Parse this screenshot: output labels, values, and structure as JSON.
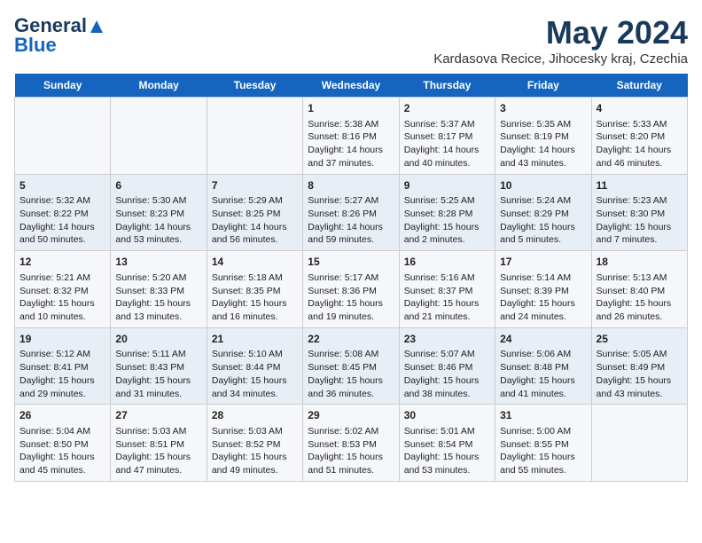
{
  "header": {
    "logo_line1": "General",
    "logo_line2": "Blue",
    "title": "May 2024",
    "subtitle": "Kardasova Recice, Jihocesky kraj, Czechia"
  },
  "days_of_week": [
    "Sunday",
    "Monday",
    "Tuesday",
    "Wednesday",
    "Thursday",
    "Friday",
    "Saturday"
  ],
  "weeks": [
    [
      {
        "day": "",
        "content": ""
      },
      {
        "day": "",
        "content": ""
      },
      {
        "day": "",
        "content": ""
      },
      {
        "day": "1",
        "content": "Sunrise: 5:38 AM\nSunset: 8:16 PM\nDaylight: 14 hours\nand 37 minutes."
      },
      {
        "day": "2",
        "content": "Sunrise: 5:37 AM\nSunset: 8:17 PM\nDaylight: 14 hours\nand 40 minutes."
      },
      {
        "day": "3",
        "content": "Sunrise: 5:35 AM\nSunset: 8:19 PM\nDaylight: 14 hours\nand 43 minutes."
      },
      {
        "day": "4",
        "content": "Sunrise: 5:33 AM\nSunset: 8:20 PM\nDaylight: 14 hours\nand 46 minutes."
      }
    ],
    [
      {
        "day": "5",
        "content": "Sunrise: 5:32 AM\nSunset: 8:22 PM\nDaylight: 14 hours\nand 50 minutes."
      },
      {
        "day": "6",
        "content": "Sunrise: 5:30 AM\nSunset: 8:23 PM\nDaylight: 14 hours\nand 53 minutes."
      },
      {
        "day": "7",
        "content": "Sunrise: 5:29 AM\nSunset: 8:25 PM\nDaylight: 14 hours\nand 56 minutes."
      },
      {
        "day": "8",
        "content": "Sunrise: 5:27 AM\nSunset: 8:26 PM\nDaylight: 14 hours\nand 59 minutes."
      },
      {
        "day": "9",
        "content": "Sunrise: 5:25 AM\nSunset: 8:28 PM\nDaylight: 15 hours\nand 2 minutes."
      },
      {
        "day": "10",
        "content": "Sunrise: 5:24 AM\nSunset: 8:29 PM\nDaylight: 15 hours\nand 5 minutes."
      },
      {
        "day": "11",
        "content": "Sunrise: 5:23 AM\nSunset: 8:30 PM\nDaylight: 15 hours\nand 7 minutes."
      }
    ],
    [
      {
        "day": "12",
        "content": "Sunrise: 5:21 AM\nSunset: 8:32 PM\nDaylight: 15 hours\nand 10 minutes."
      },
      {
        "day": "13",
        "content": "Sunrise: 5:20 AM\nSunset: 8:33 PM\nDaylight: 15 hours\nand 13 minutes."
      },
      {
        "day": "14",
        "content": "Sunrise: 5:18 AM\nSunset: 8:35 PM\nDaylight: 15 hours\nand 16 minutes."
      },
      {
        "day": "15",
        "content": "Sunrise: 5:17 AM\nSunset: 8:36 PM\nDaylight: 15 hours\nand 19 minutes."
      },
      {
        "day": "16",
        "content": "Sunrise: 5:16 AM\nSunset: 8:37 PM\nDaylight: 15 hours\nand 21 minutes."
      },
      {
        "day": "17",
        "content": "Sunrise: 5:14 AM\nSunset: 8:39 PM\nDaylight: 15 hours\nand 24 minutes."
      },
      {
        "day": "18",
        "content": "Sunrise: 5:13 AM\nSunset: 8:40 PM\nDaylight: 15 hours\nand 26 minutes."
      }
    ],
    [
      {
        "day": "19",
        "content": "Sunrise: 5:12 AM\nSunset: 8:41 PM\nDaylight: 15 hours\nand 29 minutes."
      },
      {
        "day": "20",
        "content": "Sunrise: 5:11 AM\nSunset: 8:43 PM\nDaylight: 15 hours\nand 31 minutes."
      },
      {
        "day": "21",
        "content": "Sunrise: 5:10 AM\nSunset: 8:44 PM\nDaylight: 15 hours\nand 34 minutes."
      },
      {
        "day": "22",
        "content": "Sunrise: 5:08 AM\nSunset: 8:45 PM\nDaylight: 15 hours\nand 36 minutes."
      },
      {
        "day": "23",
        "content": "Sunrise: 5:07 AM\nSunset: 8:46 PM\nDaylight: 15 hours\nand 38 minutes."
      },
      {
        "day": "24",
        "content": "Sunrise: 5:06 AM\nSunset: 8:48 PM\nDaylight: 15 hours\nand 41 minutes."
      },
      {
        "day": "25",
        "content": "Sunrise: 5:05 AM\nSunset: 8:49 PM\nDaylight: 15 hours\nand 43 minutes."
      }
    ],
    [
      {
        "day": "26",
        "content": "Sunrise: 5:04 AM\nSunset: 8:50 PM\nDaylight: 15 hours\nand 45 minutes."
      },
      {
        "day": "27",
        "content": "Sunrise: 5:03 AM\nSunset: 8:51 PM\nDaylight: 15 hours\nand 47 minutes."
      },
      {
        "day": "28",
        "content": "Sunrise: 5:03 AM\nSunset: 8:52 PM\nDaylight: 15 hours\nand 49 minutes."
      },
      {
        "day": "29",
        "content": "Sunrise: 5:02 AM\nSunset: 8:53 PM\nDaylight: 15 hours\nand 51 minutes."
      },
      {
        "day": "30",
        "content": "Sunrise: 5:01 AM\nSunset: 8:54 PM\nDaylight: 15 hours\nand 53 minutes."
      },
      {
        "day": "31",
        "content": "Sunrise: 5:00 AM\nSunset: 8:55 PM\nDaylight: 15 hours\nand 55 minutes."
      },
      {
        "day": "",
        "content": ""
      }
    ]
  ]
}
